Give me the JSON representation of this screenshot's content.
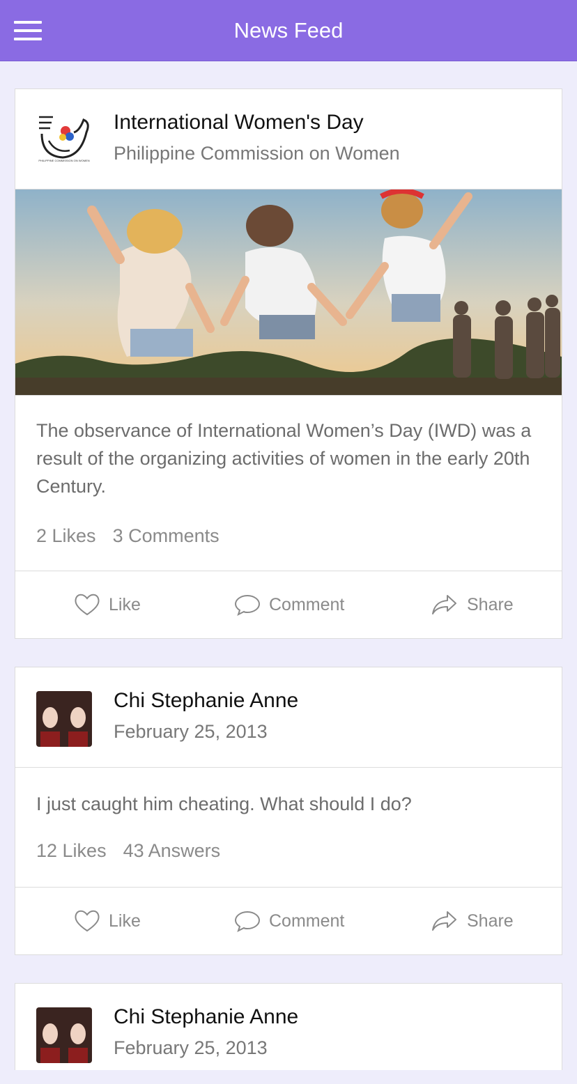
{
  "appbar": {
    "title": "News Feed"
  },
  "posts": [
    {
      "author": "International Women's Day",
      "subtitle": "Philippine Commission on Women",
      "logo_caption": "PHILIPPINE COMMISSION ON WOMEN",
      "text": "The observance of International Women’s Day (IWD) was a result of the organizing activities of women in the early 20th Century.",
      "likes": "2 Likes",
      "comments": "3 Comments",
      "actions": {
        "like": "Like",
        "comment": "Comment",
        "share": "Share"
      }
    },
    {
      "author": "Chi Stephanie Anne",
      "subtitle": "February 25, 2013",
      "text": "I just caught him cheating. What should I do?",
      "likes": "12 Likes",
      "answers": "43 Answers",
      "actions": {
        "like": "Like",
        "comment": "Comment",
        "share": "Share"
      }
    },
    {
      "author": "Chi Stephanie Anne",
      "subtitle": "February 25, 2013"
    }
  ]
}
